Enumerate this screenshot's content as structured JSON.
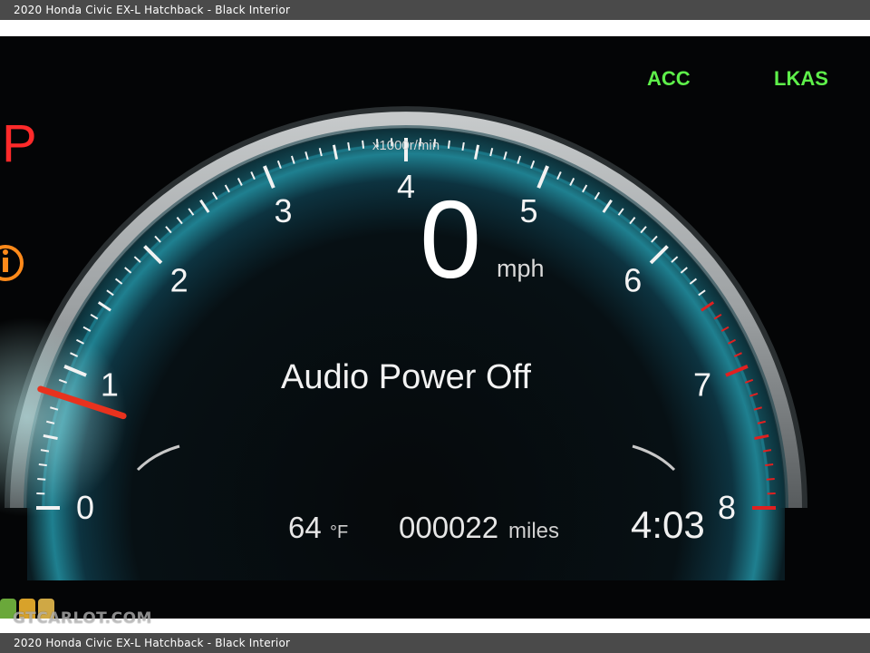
{
  "caption": {
    "top": "2020 Honda Civic EX-L Hatchback - Black Interior",
    "bottom": "2020 Honda Civic EX-L Hatchback - Black Interior"
  },
  "indicators": {
    "acc": "ACC",
    "lkas": "LKAS",
    "gear": "P"
  },
  "tachometer": {
    "labels": [
      "0",
      "1",
      "2",
      "3",
      "4",
      "5",
      "6",
      "7",
      "8"
    ],
    "unit": "x1000r/min",
    "needle_rpm": 0.8
  },
  "speed": {
    "value": "0",
    "unit": "mph"
  },
  "message": "Audio Power Off",
  "status": {
    "temperature": "64",
    "temperature_unit": "°F",
    "odometer": "000022",
    "odometer_unit": "miles",
    "clock": "4:03"
  },
  "watermark": "GTCARLOT.COM",
  "colors": {
    "indicator_green": "#5ef04a",
    "gear_red": "#ff2a2a",
    "redline": "#e02020",
    "tick_white": "#f2f2f2",
    "arc_teal": "#1a6f80",
    "caption_bg": "#4a4a4a"
  }
}
